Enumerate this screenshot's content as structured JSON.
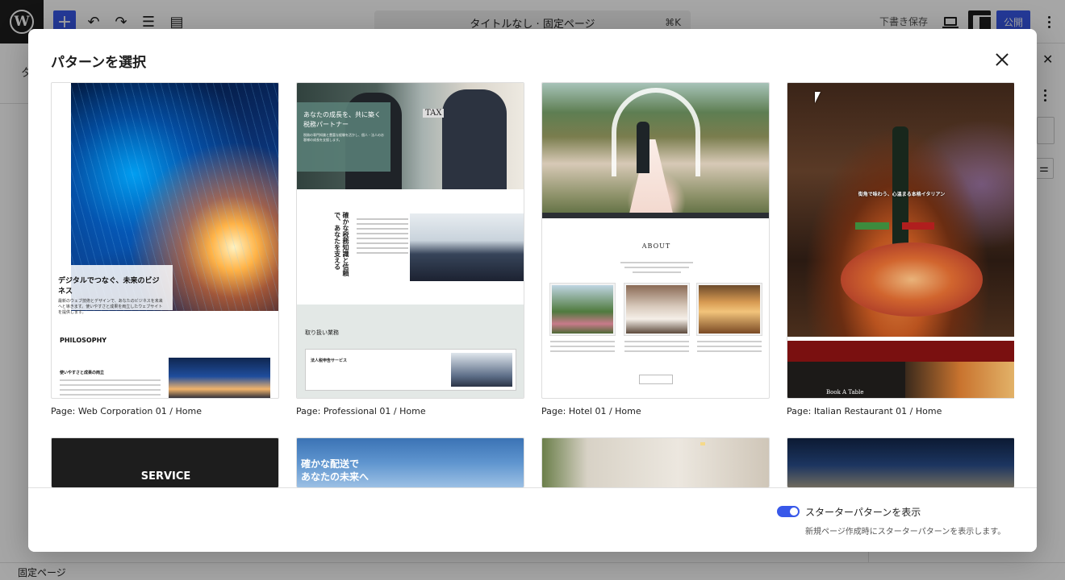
{
  "editor": {
    "title": "タイトルなし · 固定ページ",
    "shortcut": "⌘K",
    "save_draft": "下書き保存",
    "publish": "公開",
    "status": "固定ページ",
    "left_hint": "タ",
    "icons": {
      "add": "+",
      "undo": "↶",
      "redo": "↷",
      "list": "☰",
      "outline": "▤"
    }
  },
  "modal": {
    "title": "パターンを選択",
    "patterns": [
      {
        "label": "Page: Web Corporation 01 / Home"
      },
      {
        "label": "Page: Professional 01 / Home"
      },
      {
        "label": "Page: Hotel 01 / Home"
      },
      {
        "label": "Page: Italian Restaurant 01 / Home"
      }
    ],
    "previews": {
      "web": {
        "hero_title": "デジタルでつなぐ、未来のビジネス",
        "hero_text": "最新のウェブ技術とデザインで、あなたのビジネスを未来へと導きます。使いやすさと成果を両立したウェブサイトを提供します。",
        "section": "PHILOSOPHY",
        "subhead": "使いやすさと成果の両立"
      },
      "pro": {
        "hero_title": "あなたの成長を、共に築く税務パートナー",
        "hero_text": "税務の専門知識と豊富な経験を活かし、個人・法人のお客様の成長を支援します。",
        "tax": "TAX",
        "vertical": "確かな税務知識と信頼で、あなたを支える",
        "section": "取り扱い業務",
        "service": "法人税申告サービス"
      },
      "hotel": {
        "about": "ABOUT"
      },
      "italian": {
        "hero_title": "街角で味わう、心温まる本格イタリアン",
        "book": "Book A Table"
      }
    },
    "row2": {
      "service": "SERVICE",
      "delivery": "確かな配送で\nあなたの未来へ"
    },
    "footer": {
      "toggle_label": "スターターパターンを表示",
      "toggle_help": "新規ページ作成時にスターターパターンを表示します。",
      "toggle_on": true
    }
  },
  "colors": {
    "accent": "#3858e9",
    "overlay": "rgba(0,0,0,0.35)"
  }
}
